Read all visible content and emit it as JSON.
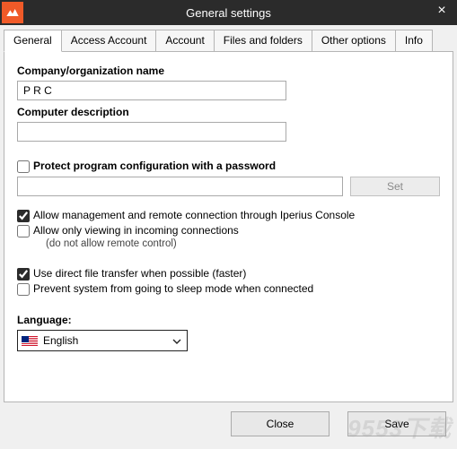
{
  "window": {
    "title": "General settings"
  },
  "tabs": {
    "t0": "General",
    "t1": "Access Account",
    "t2": "Account",
    "t3": "Files and folders",
    "t4": "Other options",
    "t5": "Info"
  },
  "form": {
    "company_label": "Company/organization name",
    "company_value": "P R C",
    "desc_label": "Computer description",
    "desc_value": "",
    "protect_label": "Protect program configuration with a password",
    "pw_value": "",
    "set_label": "Set",
    "allow_mgmt_label": "Allow management and remote connection through Iperius Console",
    "allow_view_label": "Allow only viewing in incoming connections",
    "allow_view_sub": "(do not allow remote control)",
    "direct_label": "Use direct file transfer when possible (faster)",
    "prevent_label": "Prevent system from going to sleep mode when connected",
    "language_label": "Language:",
    "language_value": "English"
  },
  "buttons": {
    "close": "Close",
    "save": "Save"
  },
  "watermark": "9553下载"
}
